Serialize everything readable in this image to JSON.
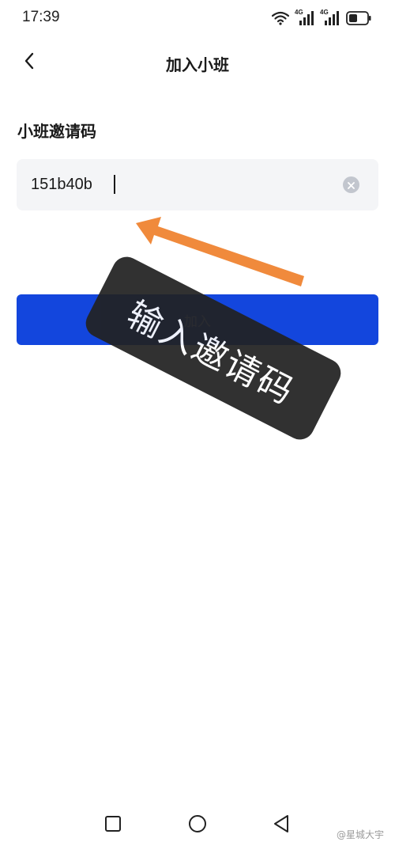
{
  "status_bar": {
    "time": "17:39",
    "network_1": "4G",
    "network_2": "4G",
    "icons": [
      "wifi-icon",
      "signal-4g-icon",
      "signal-4g-icon",
      "battery-icon"
    ]
  },
  "header": {
    "title": "加入小班",
    "back_icon": "chevron-left-icon"
  },
  "form": {
    "label": "小班邀请码",
    "invite_code_value": "151b40b",
    "clear_icon": "clear-circle-icon"
  },
  "actions": {
    "join_label": "加入"
  },
  "annotation": {
    "callout_text": "输入邀请码",
    "arrow_color": "#f08a3c",
    "callout_color": "#222222"
  },
  "colors": {
    "accent": "#1346dd",
    "input_bg": "#f4f5f7"
  },
  "watermark": "@星城大宇",
  "system_nav": {
    "icons": [
      "square-recents-icon",
      "circle-home-icon",
      "triangle-back-icon"
    ]
  }
}
